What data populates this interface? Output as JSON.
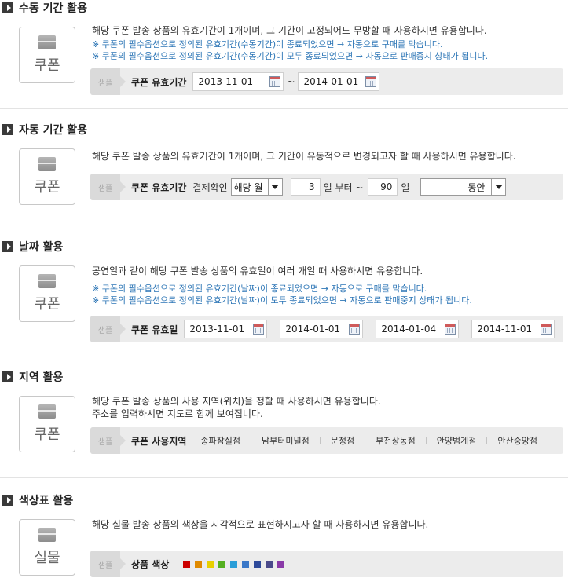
{
  "sections": [
    {
      "title": "수동 기간 활용",
      "thumb": "쿠폰",
      "desc": "해당 쿠폰 발송 상품의 유효기간이 1개이며, 그 기간이 고정되어도 무방할 때 사용하시면 유용합니다.",
      "notes": [
        "※ 쿠폰의 필수옵션으로 정의된 유효기간(수동기간)이 종료되었으면 → 자동으로 구매를 막습니다.",
        "※ 쿠폰의 필수옵션으로 정의된 유효기간(수동기간)이 모두 종료되었으면 → 자동으로 판매중지 상태가 됩니다."
      ],
      "bar": {
        "tag": "샘플",
        "label": "쿠폰 유효기간",
        "start": "2013-11-01",
        "tilde": "~",
        "end": "2014-01-01"
      }
    },
    {
      "title": "자동 기간 활용",
      "thumb": "쿠폰",
      "desc": "해당 쿠폰 발송 상품의 유효기간이 1개이며, 그 기간이 유동적으로 변경되고자 할 때 사용하시면 유용합니다.",
      "bar": {
        "tag": "샘플",
        "label": "쿠폰 유효기간",
        "confirm_label": "결제확인",
        "month_select": "해당 월",
        "day_value": "3",
        "from_label": "일 부터 ~",
        "duration_value": "90",
        "day_unit": "일",
        "period_select": "동안"
      }
    },
    {
      "title": "날짜 활용",
      "thumb": "쿠폰",
      "desc": "공연일과 같이 해당 쿠폰 발송 상품의 유효일이 여러 개일 때 사용하시면 유용합니다.",
      "notes": [
        "※ 쿠폰의 필수옵션으로 정의된 유효기간(날짜)이 종료되었으면 → 자동으로 구매를 막습니다.",
        "※ 쿠폰의 필수옵션으로 정의된 유효기간(날짜)이 모두 종료되었으면 → 자동으로 판매중지 상태가 됩니다."
      ],
      "bar": {
        "tag": "샘플",
        "label": "쿠폰 유효일",
        "dates": [
          "2013-11-01",
          "2014-01-01",
          "2014-01-04",
          "2014-11-01"
        ]
      }
    },
    {
      "title": "지역 활용",
      "thumb": "쿠폰",
      "desc": "해당 쿠폰 발송 상품의 사용 지역(위치)을 정할 때 사용하시면 유용합니다.",
      "desc2": "주소를 입력하시면 지도로 함께 보여집니다.",
      "bar": {
        "tag": "샘플",
        "label": "쿠폰 사용지역",
        "regions": [
          "송파잠실점",
          "남부터미널점",
          "문정점",
          "부천상동점",
          "안양범계점",
          "안산중앙점"
        ]
      }
    },
    {
      "title": "색상표 활용",
      "thumb": "실물",
      "desc": "해당 실물 발송 상품의 색상을 시각적으로 표현하시고자 할 때 사용하시면 유용합니다.",
      "bar": {
        "tag": "샘플",
        "label": "상품 색상",
        "colors": [
          "#cc0000",
          "#e08a00",
          "#e8d000",
          "#55b020",
          "#2a9ed8",
          "#3a78c8",
          "#2e4a9a",
          "#4a4a8a",
          "#8a3aa8"
        ]
      }
    }
  ]
}
